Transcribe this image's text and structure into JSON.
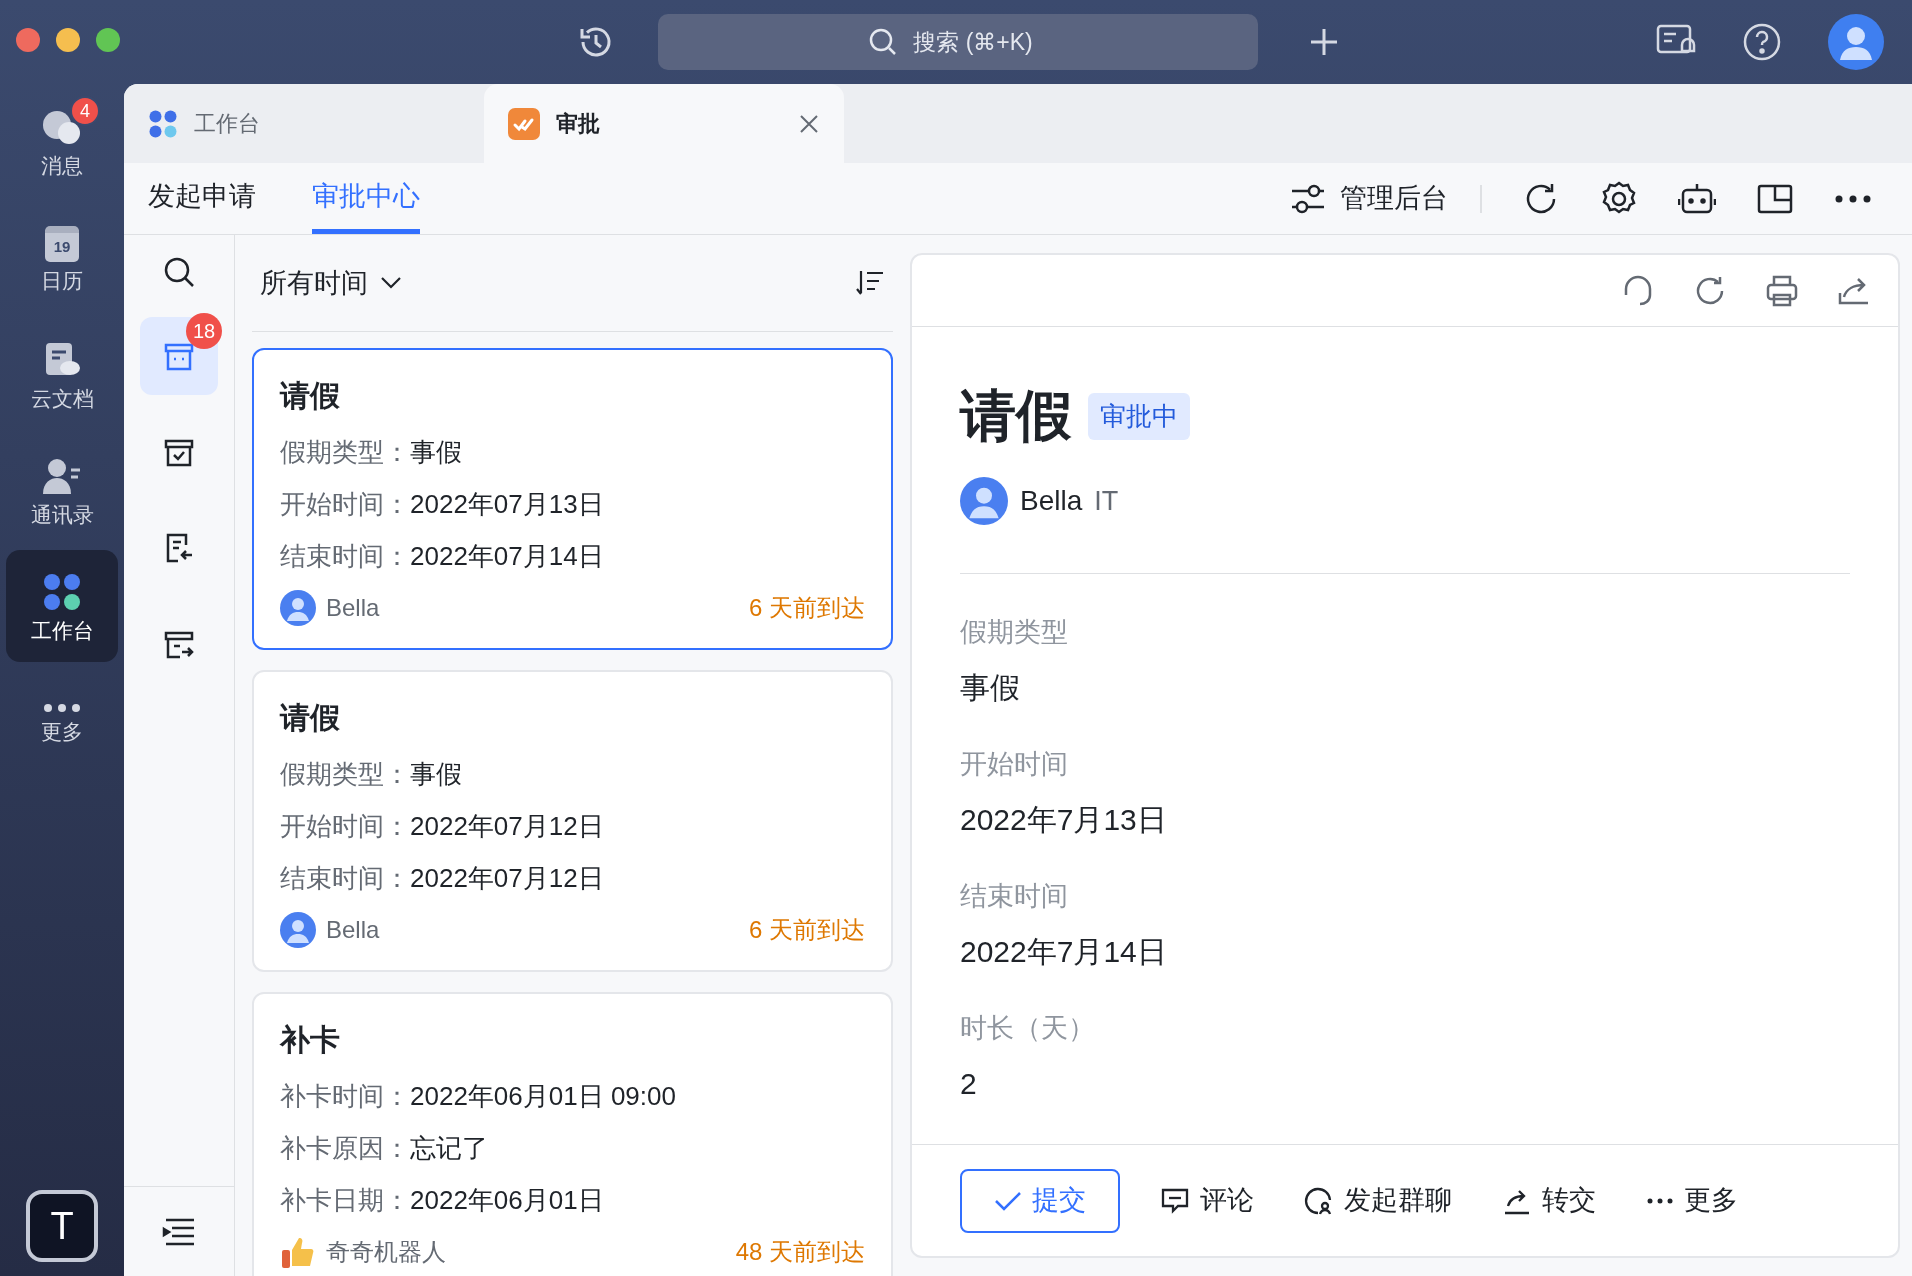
{
  "rail": {
    "items": [
      {
        "label": "消息",
        "kind": "chat",
        "badge": "4",
        "selected": false
      },
      {
        "label": "日历",
        "kind": "calendar",
        "day": "19",
        "selected": false
      },
      {
        "label": "云文档",
        "kind": "doc",
        "selected": false
      },
      {
        "label": "通讯录",
        "kind": "contacts",
        "selected": false
      },
      {
        "label": "工作台",
        "kind": "apps",
        "selected": true
      },
      {
        "label": "更多",
        "kind": "more",
        "selected": false
      }
    ],
    "user_initial": "T"
  },
  "top_bar": {
    "search_placeholder": "搜索 (⌘+K)"
  },
  "tabs": [
    {
      "label": "工作台",
      "kind": "apps",
      "selected": false
    },
    {
      "label": "审批",
      "kind": "approval",
      "selected": true
    }
  ],
  "subnav": {
    "items": [
      {
        "label": "发起申请",
        "selected": false
      },
      {
        "label": "审批中心",
        "selected": true
      }
    ],
    "admin": "管理后台"
  },
  "side_icons": [
    {
      "kind": "inbox",
      "badge": "18",
      "selected": true
    },
    {
      "kind": "done",
      "selected": false
    },
    {
      "kind": "sent",
      "selected": false
    },
    {
      "kind": "cc",
      "selected": false
    }
  ],
  "list": {
    "filter": "所有时间",
    "cards": [
      {
        "title": "请假",
        "selected": true,
        "fields": [
          {
            "label": "假期类型：",
            "value": "事假"
          },
          {
            "label": "开始时间：",
            "value": "2022年07月13日"
          },
          {
            "label": "结束时间：",
            "value": "2022年07月14日"
          }
        ],
        "user": "Bella",
        "kind": "person",
        "arrived": "6 天前到达"
      },
      {
        "title": "请假",
        "selected": false,
        "fields": [
          {
            "label": "假期类型：",
            "value": "事假"
          },
          {
            "label": "开始时间：",
            "value": "2022年07月12日"
          },
          {
            "label": "结束时间：",
            "value": "2022年07月12日"
          }
        ],
        "user": "Bella",
        "kind": "person",
        "arrived": "6 天前到达"
      },
      {
        "title": "补卡",
        "selected": false,
        "fields": [
          {
            "label": "补卡时间：",
            "value": "2022年06月01日 09:00"
          },
          {
            "label": "补卡原因：",
            "value": "忘记了"
          },
          {
            "label": "补卡日期：",
            "value": "2022年06月01日"
          }
        ],
        "user": "奇奇机器人",
        "kind": "bot",
        "arrived": "48 天前到达"
      }
    ]
  },
  "detail": {
    "title": "请假",
    "status": "审批中",
    "applicant": "Bella",
    "department": "IT",
    "fields": [
      {
        "label": "假期类型",
        "value": "事假"
      },
      {
        "label": "开始时间",
        "value": "2022年7月13日"
      },
      {
        "label": "结束时间",
        "value": "2022年7月14日"
      },
      {
        "label": "时长（天）",
        "value": "2"
      }
    ],
    "actions": [
      {
        "label": "提交",
        "kind": "primary"
      },
      {
        "label": "评论",
        "kind": "comment"
      },
      {
        "label": "发起群聊",
        "kind": "chat"
      },
      {
        "label": "转交",
        "kind": "transfer"
      },
      {
        "label": "更多",
        "kind": "more"
      }
    ]
  }
}
